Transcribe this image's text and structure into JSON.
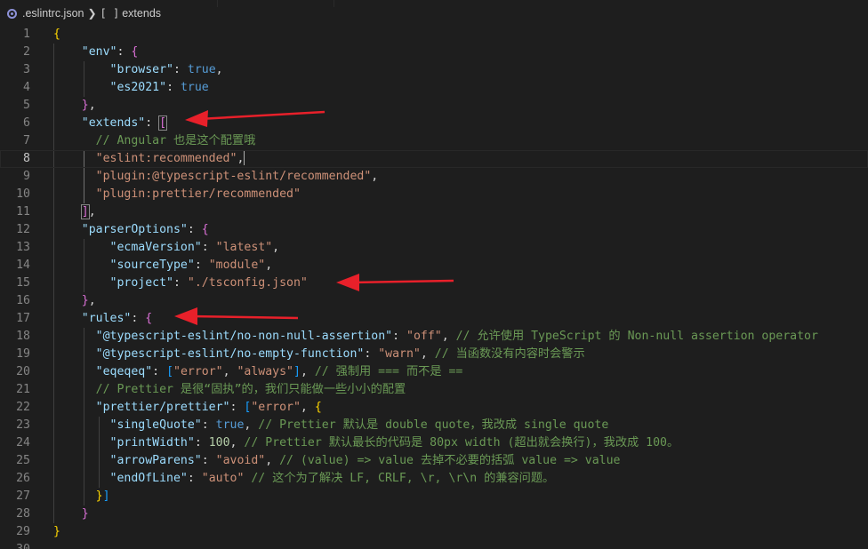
{
  "breadcrumb": {
    "file": ".eslintrc.json",
    "array_icon": "[ ]",
    "symbol": "extends",
    "file_icon": "eslint-config-icon",
    "separator_icon": "chevron-right-icon"
  },
  "editor": {
    "current_line": 8,
    "lines": [
      {
        "n": "1",
        "tokens": [
          {
            "t": "{",
            "c": "br1"
          }
        ]
      },
      {
        "n": "2",
        "tokens": [
          {
            "t": "    "
          },
          {
            "t": "\"env\"",
            "c": "k"
          },
          {
            "t": ": ",
            "c": "p"
          },
          {
            "t": "{",
            "c": "br2"
          }
        ]
      },
      {
        "n": "3",
        "tokens": [
          {
            "t": "        "
          },
          {
            "t": "\"browser\"",
            "c": "k"
          },
          {
            "t": ": ",
            "c": "p"
          },
          {
            "t": "true",
            "c": "b"
          },
          {
            "t": ",",
            "c": "p"
          }
        ]
      },
      {
        "n": "4",
        "tokens": [
          {
            "t": "        "
          },
          {
            "t": "\"es2021\"",
            "c": "k"
          },
          {
            "t": ": ",
            "c": "p"
          },
          {
            "t": "true",
            "c": "b"
          }
        ]
      },
      {
        "n": "5",
        "tokens": [
          {
            "t": "    "
          },
          {
            "t": "}",
            "c": "br2"
          },
          {
            "t": ",",
            "c": "p"
          }
        ]
      },
      {
        "n": "6",
        "tokens": [
          {
            "t": "    "
          },
          {
            "t": "\"extends\"",
            "c": "k"
          },
          {
            "t": ": ",
            "c": "p"
          },
          {
            "t": "[",
            "c": "br2 sel-br"
          }
        ]
      },
      {
        "n": "7",
        "tokens": [
          {
            "t": "      "
          },
          {
            "t": "// Angular 也是这个配置哦",
            "c": "c"
          }
        ]
      },
      {
        "n": "8",
        "tokens": [
          {
            "t": "      "
          },
          {
            "t": "\"eslint:recommended\"",
            "c": "s"
          },
          {
            "t": ",",
            "c": "p"
          },
          {
            "cursor": true
          }
        ]
      },
      {
        "n": "9",
        "tokens": [
          {
            "t": "      "
          },
          {
            "t": "\"plugin:@typescript-eslint/recommended\"",
            "c": "s"
          },
          {
            "t": ",",
            "c": "p"
          }
        ]
      },
      {
        "n": "10",
        "tokens": [
          {
            "t": "      "
          },
          {
            "t": "\"plugin:prettier/recommended\"",
            "c": "s"
          }
        ]
      },
      {
        "n": "11",
        "tokens": [
          {
            "t": "    "
          },
          {
            "t": "]",
            "c": "br2 sel-br"
          },
          {
            "t": ",",
            "c": "p"
          }
        ]
      },
      {
        "n": "12",
        "tokens": [
          {
            "t": "    "
          },
          {
            "t": "\"parserOptions\"",
            "c": "k"
          },
          {
            "t": ": ",
            "c": "p"
          },
          {
            "t": "{",
            "c": "br2"
          }
        ]
      },
      {
        "n": "13",
        "tokens": [
          {
            "t": "        "
          },
          {
            "t": "\"ecmaVersion\"",
            "c": "k"
          },
          {
            "t": ": ",
            "c": "p"
          },
          {
            "t": "\"latest\"",
            "c": "s"
          },
          {
            "t": ",",
            "c": "p"
          }
        ]
      },
      {
        "n": "14",
        "tokens": [
          {
            "t": "        "
          },
          {
            "t": "\"sourceType\"",
            "c": "k"
          },
          {
            "t": ": ",
            "c": "p"
          },
          {
            "t": "\"module\"",
            "c": "s"
          },
          {
            "t": ",",
            "c": "p"
          }
        ]
      },
      {
        "n": "15",
        "tokens": [
          {
            "t": "        "
          },
          {
            "t": "\"project\"",
            "c": "k"
          },
          {
            "t": ": ",
            "c": "p"
          },
          {
            "t": "\"./tsconfig.json\"",
            "c": "s"
          }
        ]
      },
      {
        "n": "16",
        "tokens": [
          {
            "t": "    "
          },
          {
            "t": "}",
            "c": "br2"
          },
          {
            "t": ",",
            "c": "p"
          }
        ]
      },
      {
        "n": "17",
        "tokens": [
          {
            "t": "    "
          },
          {
            "t": "\"rules\"",
            "c": "k"
          },
          {
            "t": ": ",
            "c": "p"
          },
          {
            "t": "{",
            "c": "br2"
          }
        ]
      },
      {
        "n": "18",
        "tokens": [
          {
            "t": "      "
          },
          {
            "t": "\"@typescript-eslint/no-non-null-assertion\"",
            "c": "k"
          },
          {
            "t": ": ",
            "c": "p"
          },
          {
            "t": "\"off\"",
            "c": "s"
          },
          {
            "t": ", ",
            "c": "p"
          },
          {
            "t": "// 允许使用 TypeScript 的 Non-null assertion operator",
            "c": "c"
          }
        ]
      },
      {
        "n": "19",
        "tokens": [
          {
            "t": "      "
          },
          {
            "t": "\"@typescript-eslint/no-empty-function\"",
            "c": "k"
          },
          {
            "t": ": ",
            "c": "p"
          },
          {
            "t": "\"warn\"",
            "c": "s"
          },
          {
            "t": ", ",
            "c": "p"
          },
          {
            "t": "// 当函数没有内容时会警示",
            "c": "c"
          }
        ]
      },
      {
        "n": "20",
        "tokens": [
          {
            "t": "      "
          },
          {
            "t": "\"eqeqeq\"",
            "c": "k"
          },
          {
            "t": ": ",
            "c": "p"
          },
          {
            "t": "[",
            "c": "br3"
          },
          {
            "t": "\"error\"",
            "c": "s"
          },
          {
            "t": ", ",
            "c": "p"
          },
          {
            "t": "\"always\"",
            "c": "s"
          },
          {
            "t": "]",
            "c": "br3"
          },
          {
            "t": ", ",
            "c": "p"
          },
          {
            "t": "// 强制用 === 而不是 ==",
            "c": "c"
          }
        ]
      },
      {
        "n": "21",
        "tokens": [
          {
            "t": "      "
          },
          {
            "t": "// Prettier 是很“固执”的，我们只能做一些小小的配置",
            "c": "c"
          }
        ]
      },
      {
        "n": "22",
        "tokens": [
          {
            "t": "      "
          },
          {
            "t": "\"prettier/prettier\"",
            "c": "k"
          },
          {
            "t": ": ",
            "c": "p"
          },
          {
            "t": "[",
            "c": "br3"
          },
          {
            "t": "\"error\"",
            "c": "s"
          },
          {
            "t": ", ",
            "c": "p"
          },
          {
            "t": "{",
            "c": "br1"
          }
        ]
      },
      {
        "n": "23",
        "tokens": [
          {
            "t": "        "
          },
          {
            "t": "\"singleQuote\"",
            "c": "k"
          },
          {
            "t": ": ",
            "c": "p"
          },
          {
            "t": "true",
            "c": "b"
          },
          {
            "t": ", ",
            "c": "p"
          },
          {
            "t": "// Prettier 默认是 double quote，我改成 single quote",
            "c": "c"
          }
        ]
      },
      {
        "n": "24",
        "tokens": [
          {
            "t": "        "
          },
          {
            "t": "\"printWidth\"",
            "c": "k"
          },
          {
            "t": ": ",
            "c": "p"
          },
          {
            "t": "100",
            "c": "n"
          },
          {
            "t": ", ",
            "c": "p"
          },
          {
            "t": "// Prettier 默认最长的代码是 80px width (超出就会换行)，我改成 100。",
            "c": "c"
          }
        ]
      },
      {
        "n": "25",
        "tokens": [
          {
            "t": "        "
          },
          {
            "t": "\"arrowParens\"",
            "c": "k"
          },
          {
            "t": ": ",
            "c": "p"
          },
          {
            "t": "\"avoid\"",
            "c": "s"
          },
          {
            "t": ", ",
            "c": "p"
          },
          {
            "t": "// (value) => value 去掉不必要的括弧 value => value",
            "c": "c"
          }
        ]
      },
      {
        "n": "26",
        "tokens": [
          {
            "t": "        "
          },
          {
            "t": "\"endOfLine\"",
            "c": "k"
          },
          {
            "t": ": ",
            "c": "p"
          },
          {
            "t": "\"auto\"",
            "c": "s"
          },
          {
            "t": " ",
            "c": "p"
          },
          {
            "t": "// 这个为了解决 LF, CRLF, \\r, \\r\\n 的兼容问题。",
            "c": "c"
          }
        ]
      },
      {
        "n": "27",
        "tokens": [
          {
            "t": "      "
          },
          {
            "t": "}",
            "c": "br1"
          },
          {
            "t": "]",
            "c": "br3"
          }
        ]
      },
      {
        "n": "28",
        "tokens": [
          {
            "t": "    "
          },
          {
            "t": "}",
            "c": "br2"
          }
        ]
      },
      {
        "n": "29",
        "tokens": [
          {
            "t": "}",
            "c": "br1"
          }
        ]
      },
      {
        "n": "30",
        "tokens": []
      }
    ]
  },
  "annotation_arrows": {
    "count": 4,
    "color": "#e8202a"
  }
}
